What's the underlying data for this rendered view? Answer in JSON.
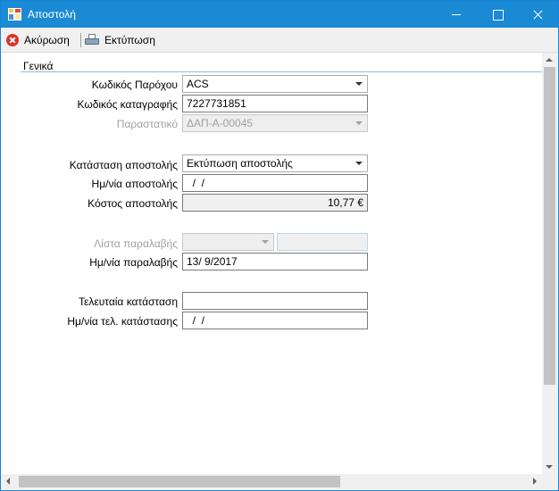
{
  "window": {
    "title": "Αποστολή"
  },
  "toolbar": {
    "cancel_label": "Ακύρωση",
    "print_label": "Εκτύπωση"
  },
  "section": {
    "title": "Γενικά"
  },
  "fields": {
    "provider_code": {
      "label": "Κωδικός Παρόχου",
      "value": "ACS"
    },
    "registration_code": {
      "label": "Κωδικός καταγραφής",
      "value": "7227731851"
    },
    "voucher": {
      "label": "Παραστατικό",
      "value": "ΔΑΠ-Α-00045"
    },
    "shipment_status": {
      "label": "Κατάσταση αποστολής",
      "value": "Εκτύπωση αποστολής"
    },
    "shipment_date": {
      "label": "Ημ/νία αποστολής",
      "value": "  /  /"
    },
    "shipment_cost": {
      "label": "Κόστος αποστολής",
      "value": "10,77 €"
    },
    "receipt_list": {
      "label": "Λίστα παραλαβής",
      "value": "",
      "value2": ""
    },
    "receipt_date": {
      "label": "Ημ/νία παραλαβής",
      "value": "13/ 9/2017"
    },
    "last_status": {
      "label": "Τελευταία κατάσταση",
      "value": ""
    },
    "last_status_date": {
      "label": "Ημ/νία τελ. κατάστασης",
      "value": "  /  /"
    }
  },
  "icons": {
    "app": "app-icon",
    "cancel": "cancel-icon",
    "print": "printer-icon"
  }
}
